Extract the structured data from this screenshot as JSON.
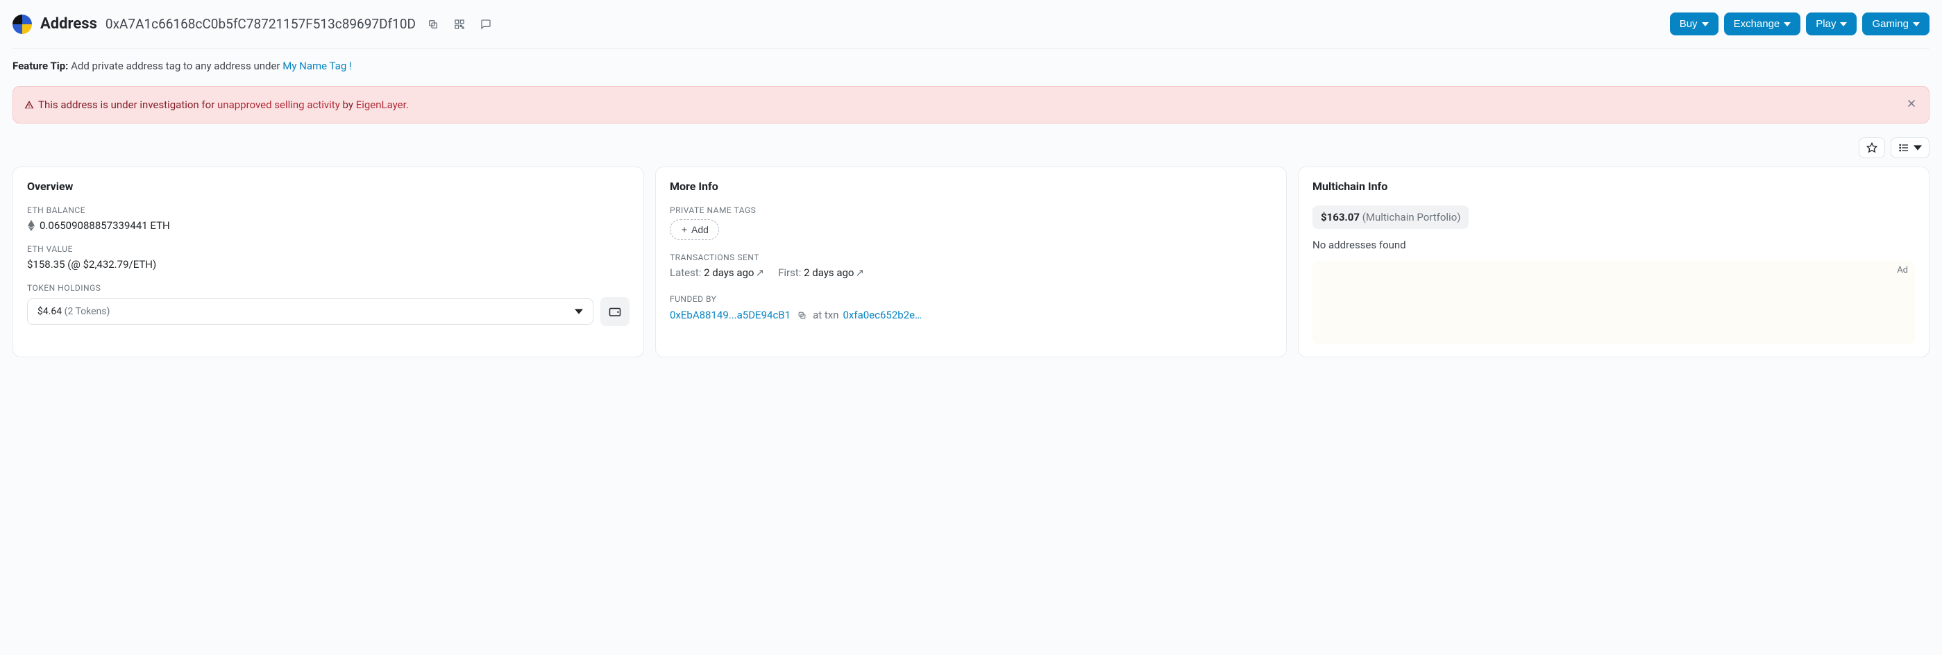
{
  "header": {
    "title": "Address",
    "hash": "0xA7A1c66168cC0b5fC78721157F513c89697Df10D",
    "buttons": {
      "buy": "Buy",
      "exchange": "Exchange",
      "play": "Play",
      "gaming": "Gaming"
    }
  },
  "tip": {
    "bold": "Feature Tip:",
    "text": " Add private address tag to any address under ",
    "link": "My Name Tag !"
  },
  "alert": {
    "prefix": "This address is under investigation for ",
    "link1": "unapproved selling activity",
    "middle": " by ",
    "link2": "EigenLayer",
    "suffix": "."
  },
  "overview": {
    "title": "Overview",
    "eth_balance_label": "ETH BALANCE",
    "eth_balance": "0.06509088857339441 ETH",
    "eth_value_label": "ETH VALUE",
    "eth_value": "$158.35 (@ $2,432.79/ETH)",
    "token_label": "TOKEN HOLDINGS",
    "token_value": "$4.64",
    "token_count": "(2 Tokens)"
  },
  "moreinfo": {
    "title": "More Info",
    "tags_label": "PRIVATE NAME TAGS",
    "add_label": "Add",
    "tx_label": "TRANSACTIONS SENT",
    "latest_label": "Latest:",
    "latest_value": "2 days ago",
    "first_label": "First:",
    "first_value": "2 days ago",
    "funded_label": "FUNDED BY",
    "funded_addr": "0xEbA88149...a5DE94cB1",
    "at_txn": "at txn",
    "txn_hash": "0xfa0ec652b2e…"
  },
  "multichain": {
    "title": "Multichain Info",
    "chip_value": "$163.07",
    "chip_label": "(Multichain Portfolio)",
    "no_addresses": "No addresses found",
    "ad_label": "Ad"
  }
}
